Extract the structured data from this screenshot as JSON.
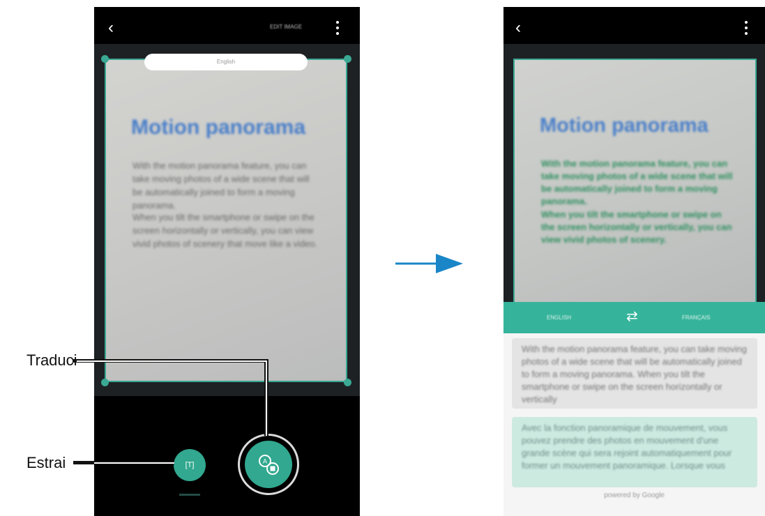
{
  "left_screen": {
    "top_bar_title": "EDIT IMAGE",
    "language_pill": "English",
    "document_title": "Motion panorama",
    "document_paragraph_1": "With the motion panorama feature, you can take moving photos of a wide scene that will be automatically joined to form a moving panorama.",
    "document_paragraph_2": "When you tilt the smartphone or swipe on the screen horizontally or vertically, you can view vivid photos of scenery that move like a video.",
    "extract_icon_glyph": "[T]"
  },
  "callouts": {
    "translate": "Traduci",
    "extract": "Estrai"
  },
  "right_screen": {
    "document_title": "Motion panorama",
    "translated_paragraph_1": "With the motion panorama feature, you can take moving photos of a wide scene that will be automatically joined to form a moving panorama.",
    "translated_paragraph_2": "When you tilt the smartphone or swipe on the screen horizontally or vertically, you can view vivid photos of scenery.",
    "source_language": "ENGLISH",
    "target_language": "FRANÇAIS",
    "source_text": "With the motion panorama feature, you can take moving photos of a wide scene that will be automatically joined to form a moving panorama. When you tilt the smartphone or swipe on the screen horizontally or vertically",
    "target_text": "Avec la fonction panoramique de mouvement, vous pouvez prendre des photos en mouvement d'une grande scène qui sera rejoint automatiquement pour former un mouvement panoramique. Lorsque vous",
    "powered_by": "powered by Google"
  },
  "icons": {
    "back": "back-chevron-icon",
    "menu": "more-options-icon",
    "extract": "extract-text-icon",
    "translate": "translate-icon",
    "swap": "swap-languages-icon",
    "arrow": "right-arrow-icon"
  },
  "colors": {
    "accent_teal": "#31a88f",
    "blue_arrow": "#1a86c8",
    "title_blue": "#4a7fc9"
  }
}
